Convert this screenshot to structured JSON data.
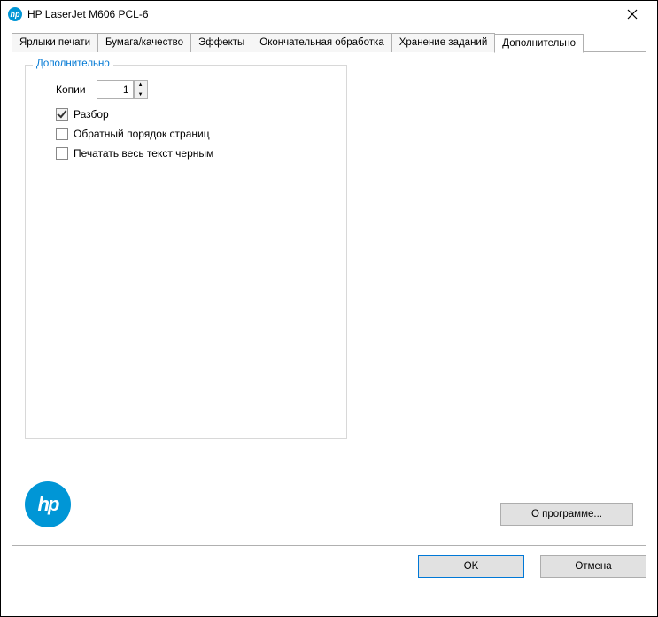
{
  "window": {
    "title": "HP LaserJet M606 PCL-6"
  },
  "tabs": [
    {
      "label": "Ярлыки печати"
    },
    {
      "label": "Бумага/качество"
    },
    {
      "label": "Эффекты"
    },
    {
      "label": "Окончательная обработка"
    },
    {
      "label": "Хранение заданий"
    },
    {
      "label": "Дополнительно"
    }
  ],
  "group": {
    "legend": "Дополнительно",
    "copies_label": "Копии",
    "copies_value": "1",
    "collate_label": "Разбор",
    "reverse_label": "Обратный порядок страниц",
    "blacktext_label": "Печатать весь текст черным"
  },
  "buttons": {
    "about": "О программе...",
    "ok": "OK",
    "cancel": "Отмена"
  },
  "logo": {
    "text": "hp"
  }
}
